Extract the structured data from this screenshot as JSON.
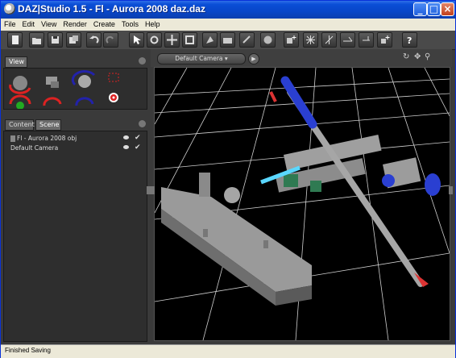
{
  "window": {
    "title": "DAZ|Studio 1.5 - Fl - Aurora 2008 daz.daz",
    "minimize": "_",
    "maximize": "□",
    "close": "×"
  },
  "menu": [
    "File",
    "Edit",
    "View",
    "Render",
    "Create",
    "Tools",
    "Help"
  ],
  "left_panel": {
    "top_tab": "View",
    "bottom_tabs": [
      "Content",
      "Scene"
    ],
    "scene_items": [
      {
        "label": "Fl - Aurora 2008 obj"
      },
      {
        "label": "Default Camera"
      }
    ]
  },
  "viewport": {
    "camera": "Default Camera"
  },
  "status": {
    "text": "Finished Saving"
  },
  "colors": {
    "titlebar": "#0a4ed6",
    "workspace_bg": "#3a3a3a",
    "viewport_bg": "#000000",
    "accent_blue": "#2a3fd1"
  },
  "icons": {
    "toolbar": [
      "new-icon",
      "open-icon",
      "save-icon",
      "merge-icon",
      "undo-icon",
      "redo-icon",
      "select-icon",
      "rotate-icon",
      "translate-icon",
      "scale-icon",
      "pose-icon",
      "camera-icon",
      "sphere-icon",
      "light-add-icon",
      "spotlight-icon",
      "pointlight-icon",
      "distant-light-icon",
      "light-plus-icon",
      "light-star-icon",
      "help-icon"
    ]
  }
}
